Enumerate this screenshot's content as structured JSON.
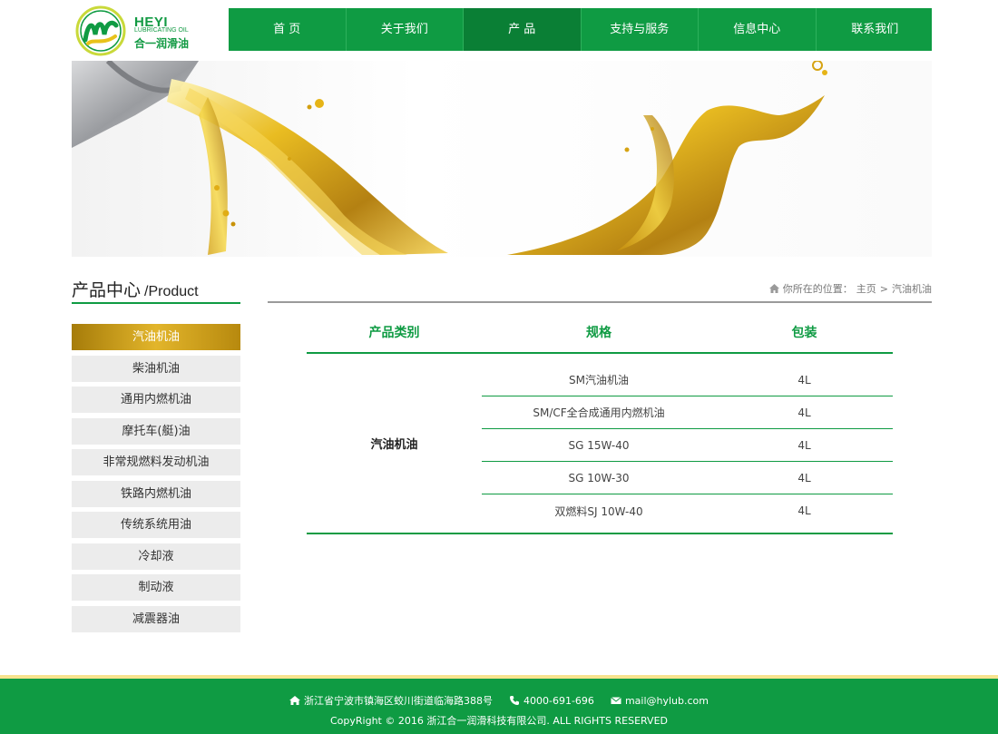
{
  "brand": {
    "name_en": "HEYI",
    "sub_en": "LUBRICATING OIL",
    "name_cn": "合一润滑油"
  },
  "nav": [
    {
      "label": "首 页"
    },
    {
      "label": "关于我们"
    },
    {
      "label": "产 品"
    },
    {
      "label": "支持与服务"
    },
    {
      "label": "信息中心"
    },
    {
      "label": "联系我们"
    }
  ],
  "nav_active_index": 2,
  "sidebar": {
    "title_cn": "产品中心",
    "title_en": "/Product",
    "items": [
      {
        "label": "汽油机油"
      },
      {
        "label": "柴油机油"
      },
      {
        "label": "通用内燃机油"
      },
      {
        "label": "摩托车(艇)油"
      },
      {
        "label": "非常规燃料发动机油"
      },
      {
        "label": "铁路内燃机油"
      },
      {
        "label": "传统系统用油"
      },
      {
        "label": "冷却液"
      },
      {
        "label": "制动液"
      },
      {
        "label": "减震器油"
      }
    ],
    "active_index": 0
  },
  "breadcrumb": {
    "prefix": "你所在的位置：",
    "home": "主页",
    "sep": ">",
    "current": "汽油机油"
  },
  "table": {
    "headers": [
      "产品类别",
      "规格",
      "包装"
    ],
    "category": "汽油机油",
    "rows": [
      {
        "spec": "SM汽油机油",
        "pack": "4L"
      },
      {
        "spec": "SM/CF全合成通用内燃机油",
        "pack": "4L"
      },
      {
        "spec": "SG 15W-40",
        "pack": "4L"
      },
      {
        "spec": "SG 10W-30",
        "pack": "4L"
      },
      {
        "spec": "双燃料SJ 10W-40",
        "pack": "4L"
      }
    ]
  },
  "footer": {
    "address": "浙江省宁波市镇海区蛟川街道临海路388号",
    "phone": "4000-691-696",
    "email": "mail@hylub.com",
    "copyright": "CopyRight © 2016 浙江合一润滑科技有限公司. ALL RIGHTS RESERVED"
  },
  "colors": {
    "brand_green": "#0f9b43",
    "nav_active": "#0a7f35",
    "gold": "#d9a81d",
    "footer_stripe": "#f7e38e"
  },
  "icons": [
    "logo-mark",
    "home-icon",
    "phone-icon",
    "mail-icon"
  ]
}
